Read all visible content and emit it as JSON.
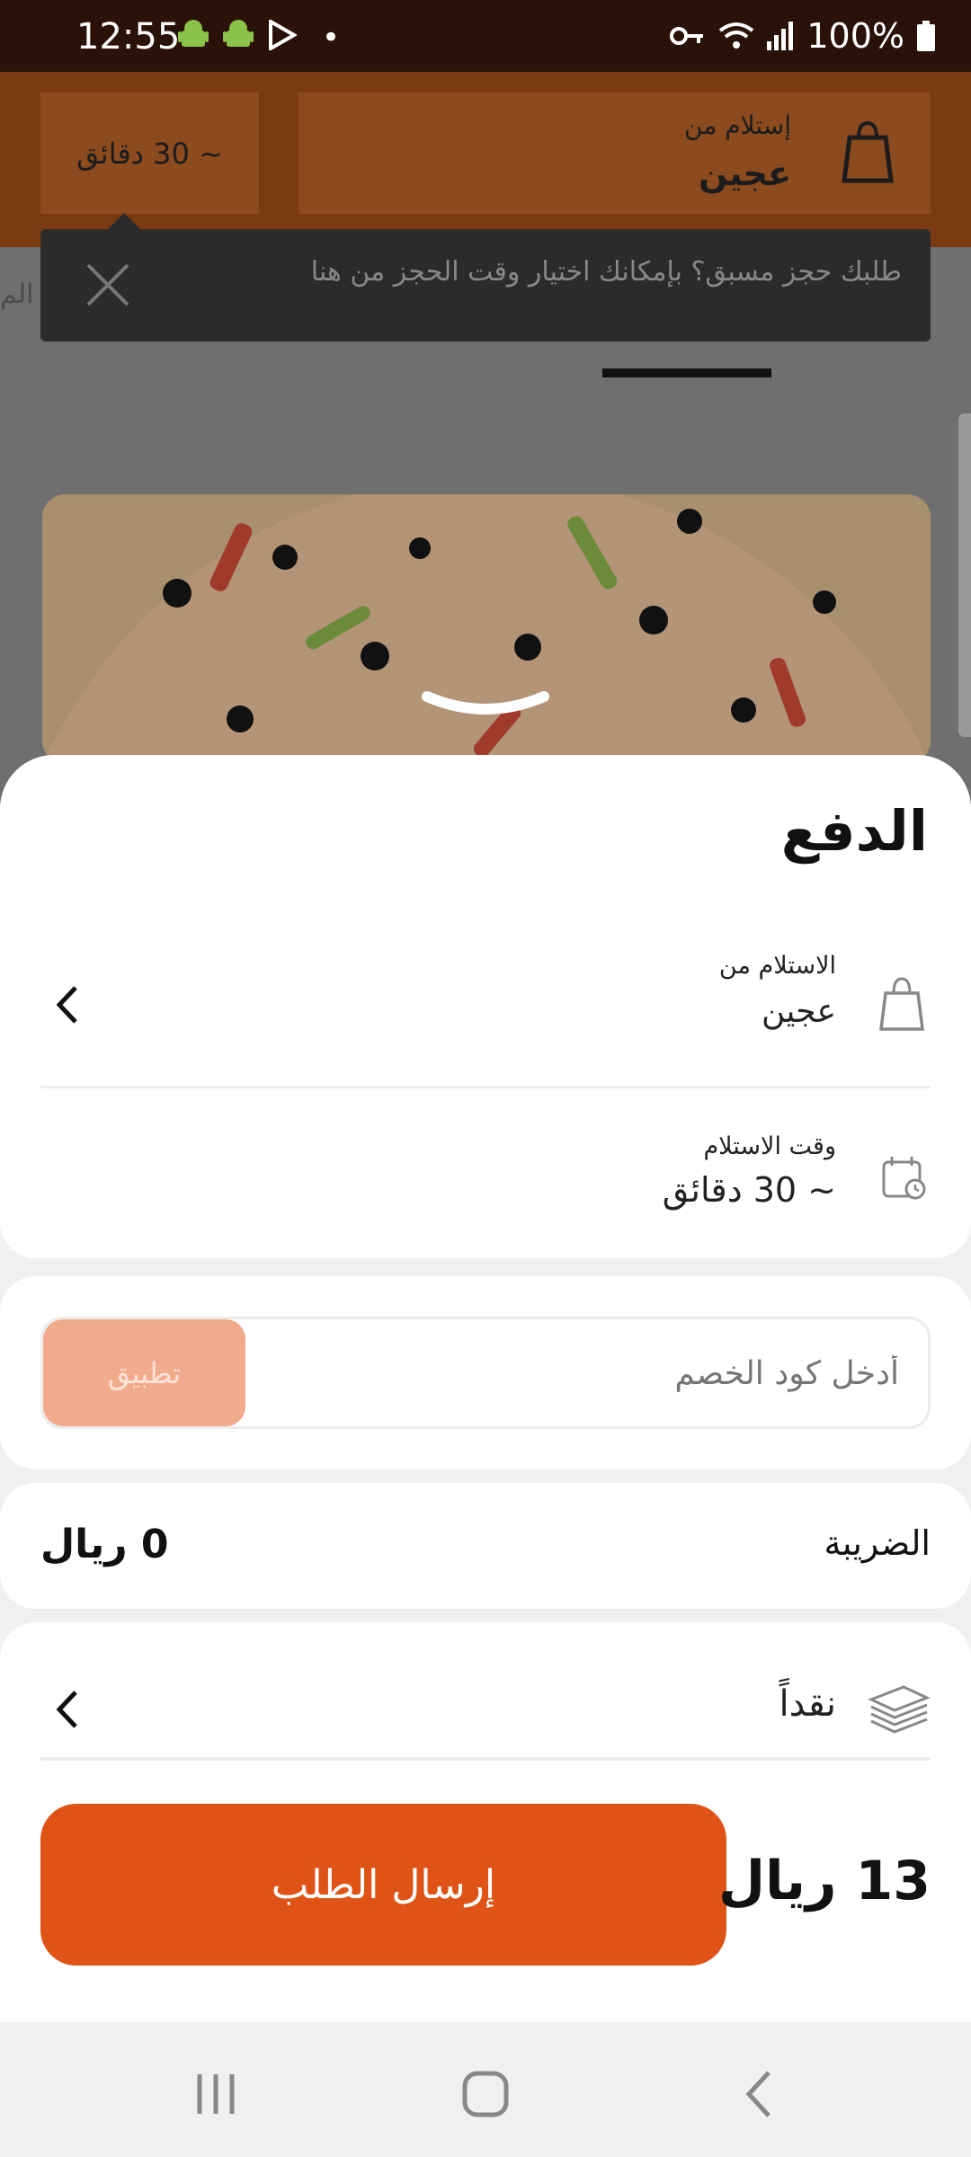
{
  "status_bar": {
    "time": "12:55",
    "dot": "•",
    "battery": "100%"
  },
  "header": {
    "time_pill": "~ 30 دقائق",
    "pickup_label": "إستلام من",
    "pickup_value": "عجين"
  },
  "tooltip": {
    "text": "طلبك حجز مسبق؟ بإمكانك اختيار وقت الحجز من هنا"
  },
  "background_side_text": "الم",
  "sheet": {
    "title": "الدفع",
    "pickup_from_label": "الاستلام من",
    "pickup_from_value": "عجين",
    "pickup_time_label": "وقت الاستلام",
    "pickup_time_value": "~ 30 دقائق",
    "promo_placeholder": "أدخل كود الخصم",
    "apply_label": "تطبيق",
    "tax_label": "الضريبة",
    "tax_value": "0 ريال",
    "payment_method": "نقداً",
    "submit_label": "إرسال الطلب",
    "total": "13 ريال"
  },
  "colors": {
    "accent": "#df5316",
    "header_bg": "#7a3a12",
    "apply_disabled": "#f2aa8c"
  }
}
